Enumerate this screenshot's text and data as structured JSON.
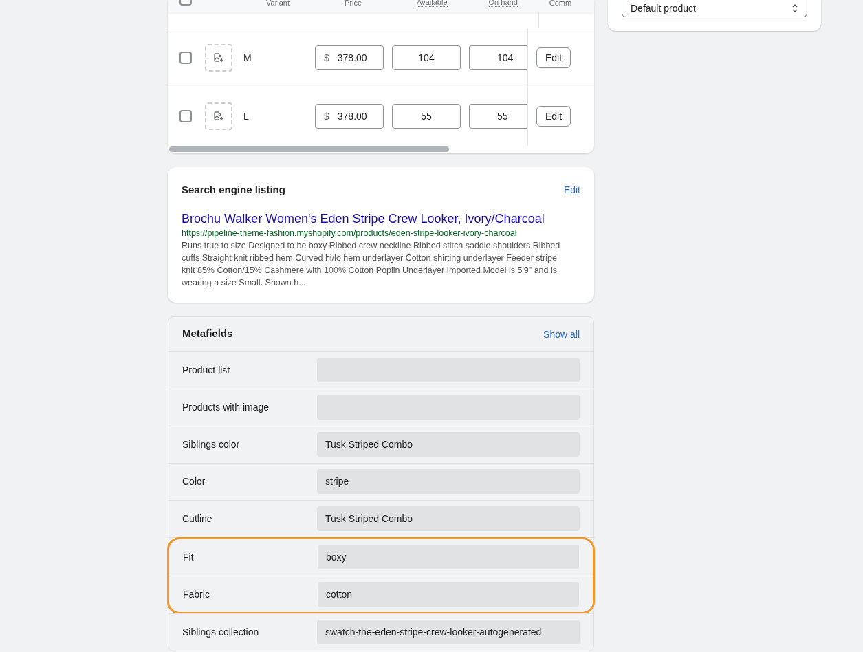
{
  "variants_table": {
    "select_all_checked": false,
    "columns": [
      "Variant",
      "Price",
      "Available",
      "On hand",
      "Comm"
    ],
    "rows": [
      {
        "name": "M",
        "checked": false,
        "currency": "$",
        "price": "378.00",
        "available": "104",
        "on_hand": "104",
        "action": "Edit"
      },
      {
        "name": "L",
        "checked": false,
        "currency": "$",
        "price": "378.00",
        "available": "55",
        "on_hand": "55",
        "action": "Edit"
      }
    ]
  },
  "template_select": {
    "value": "Default product"
  },
  "search_listing": {
    "title": "Search engine listing",
    "edit": "Edit",
    "page_title": "Brochu Walker Women's Eden Stripe Crew Looker, Ivory/Charcoal",
    "url": "https://pipeline-theme-fashion.myshopify.com/products/eden-stripe-looker-ivory-charcoal",
    "description": "Runs true to size Designed to be boxy Ribbed crew neckline Ribbed stitch saddle shoulders Ribbed cuffs Straight knit ribbed hem Curved hi/lo hem underlayer Cotton shirting underlayer Feeder stripe knit 85% Cotton/15% Cashmere with 100% Cotton Poplin Underlayer Imported Model is 5'9\" and is wearing a size Small. Shown h..."
  },
  "metafields": {
    "title": "Metafields",
    "action": "Show all",
    "rows": [
      {
        "label": "Product list",
        "highlighted": false
      },
      {
        "label": "Products with image",
        "highlighted": false
      },
      {
        "label": "Siblings color",
        "value": "Tusk Striped Combo",
        "highlighted": false
      },
      {
        "label": "Color",
        "value": "stripe",
        "highlighted": false
      },
      {
        "label": "Cutline",
        "value": "Tusk Striped Combo",
        "highlighted": false
      },
      {
        "label": "Fit",
        "value": "boxy",
        "highlighted": true
      },
      {
        "label": "Fabric",
        "value": "cotton",
        "highlighted": true
      },
      {
        "label": "Siblings collection",
        "value": "swatch-the-eden-stripe-crew-looker-autogenerated",
        "highlighted": false
      }
    ]
  }
}
